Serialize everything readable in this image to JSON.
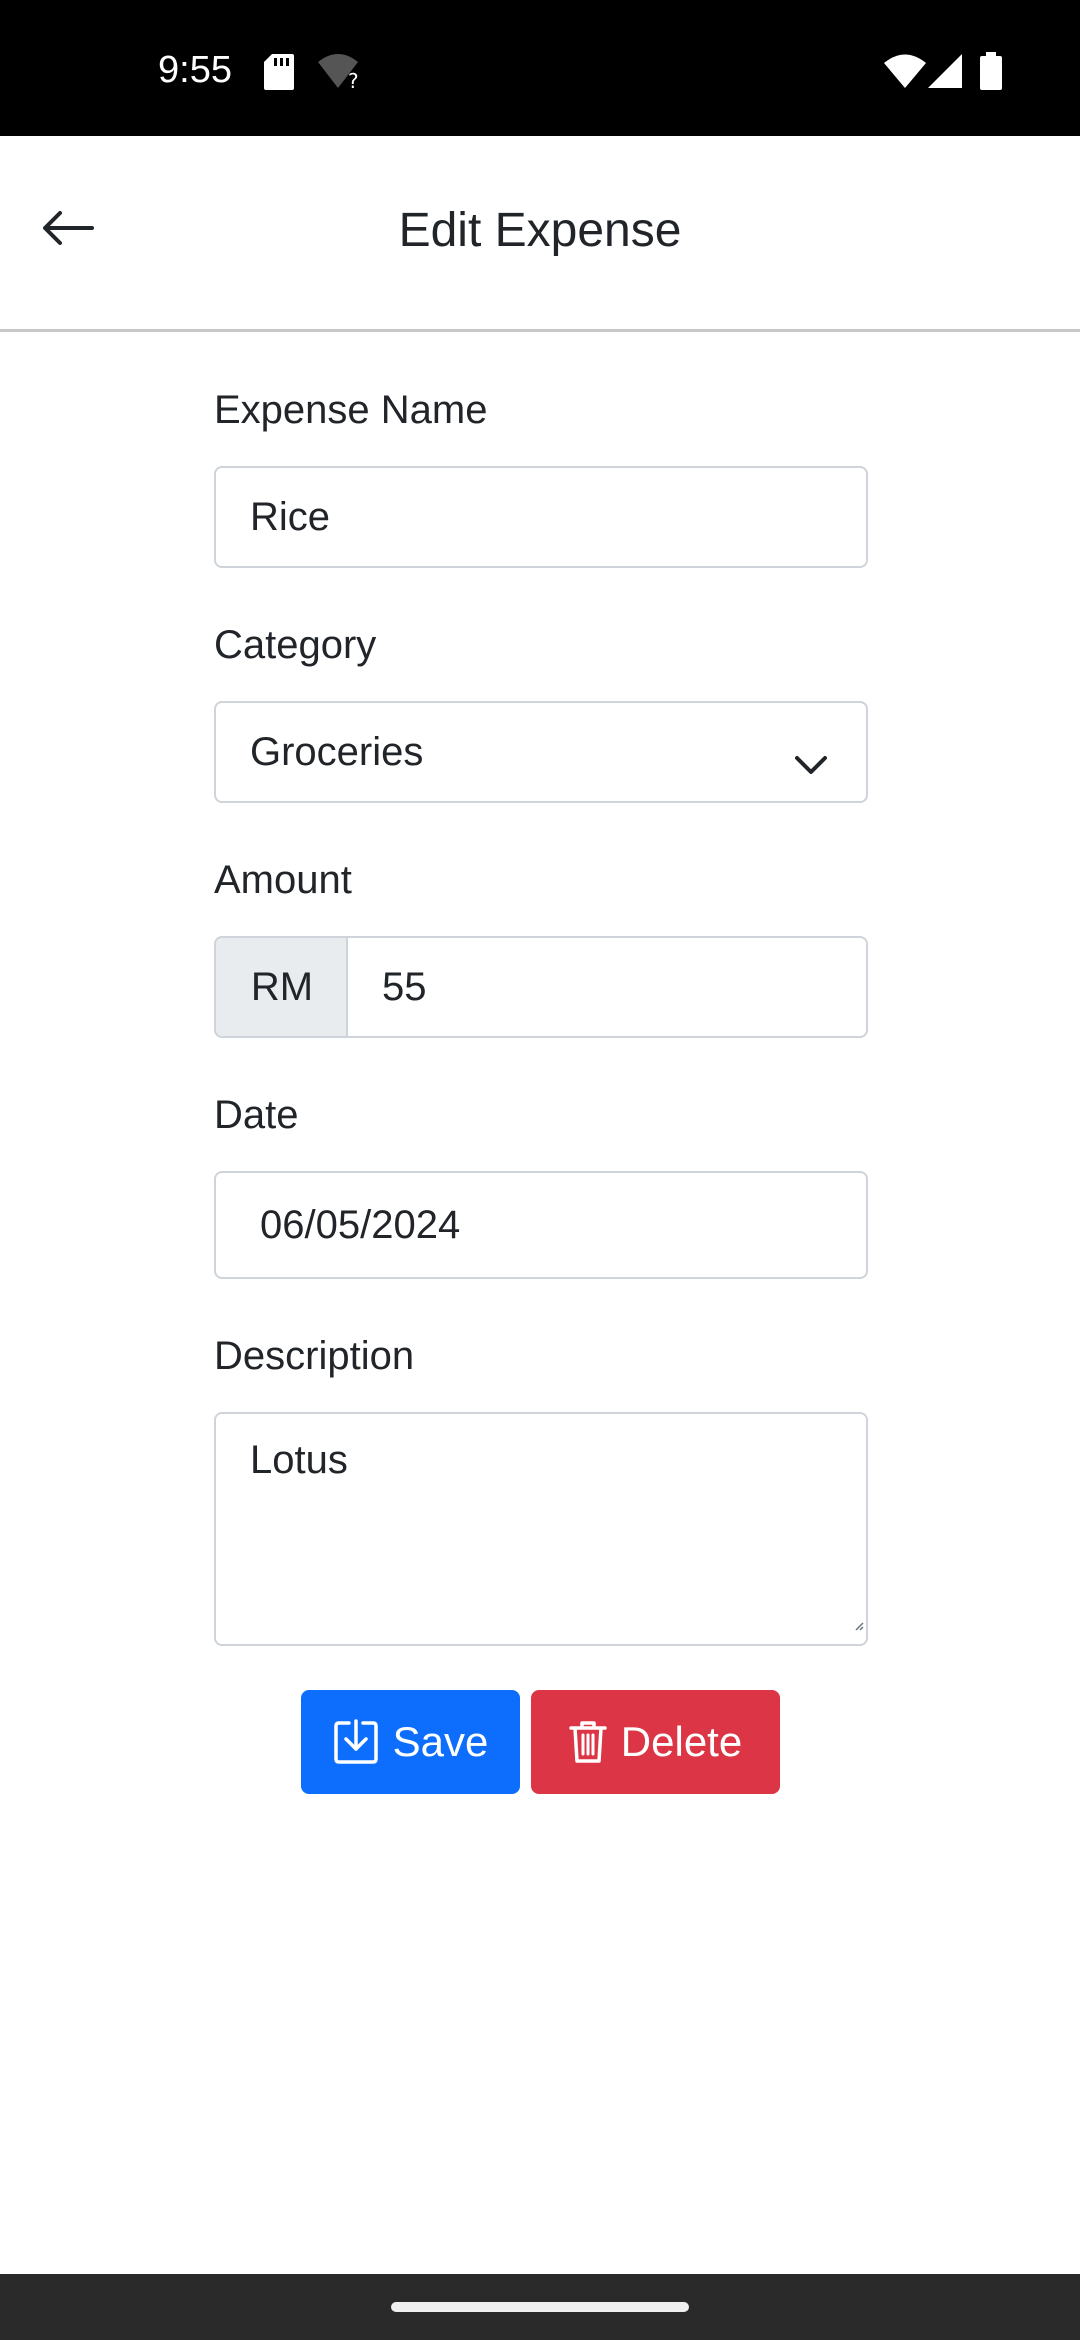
{
  "status_bar": {
    "time": "9:55",
    "icons": [
      "sd-card-icon",
      "wifi-question-icon",
      "wifi-icon",
      "signal-icon",
      "battery-icon"
    ]
  },
  "app_bar": {
    "title": "Edit Expense",
    "back_icon": "arrow-left-icon"
  },
  "form": {
    "name": {
      "label": "Expense Name",
      "value": "Rice"
    },
    "category": {
      "label": "Category",
      "value": "Groceries"
    },
    "amount": {
      "label": "Amount",
      "prefix": "RM",
      "value": "55"
    },
    "date": {
      "label": "Date",
      "value": "06/05/2024"
    },
    "description": {
      "label": "Description",
      "value": "Lotus"
    }
  },
  "actions": {
    "save_label": "Save",
    "delete_label": "Delete"
  },
  "colors": {
    "primary": "#0d6efd",
    "danger": "#dc3545",
    "input_border": "#ced4da",
    "addon_bg": "#e9ecef"
  }
}
